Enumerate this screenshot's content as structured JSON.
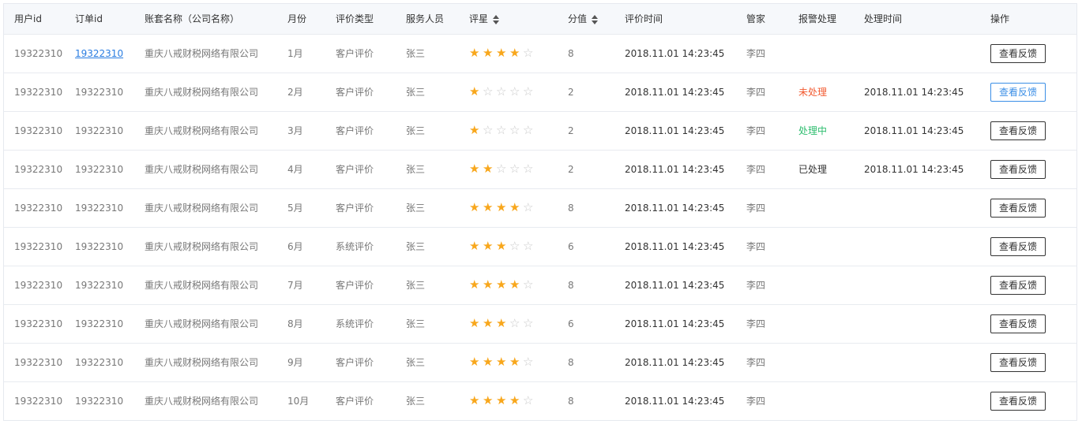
{
  "columns": {
    "user_id": "用户id",
    "order_id": "订单id",
    "account_name": "账套名称（公司名称）",
    "month": "月份",
    "eval_type": "评价类型",
    "staff": "服务人员",
    "rating": "评星",
    "score": "分值",
    "eval_time": "评价时间",
    "manager": "管家",
    "alarm": "报警处理",
    "handle_time": "处理时间",
    "actions": "操作"
  },
  "colors": {
    "star_on": "#f8a71c",
    "link": "#2a7de1",
    "status_pending": "#f25a30",
    "status_processing": "#2dbd6e",
    "button_primary": "#3a8ee6"
  },
  "icons": {
    "star": "star-icon",
    "sort": "sort-icon"
  },
  "rows": [
    {
      "user_id": "19322310",
      "order_id": "19322310",
      "account_name": "重庆八戒财税网络有限公司",
      "month": "1月",
      "eval_type": "客户评价",
      "staff": "张三",
      "rating": 4,
      "score": "8",
      "eval_time": "2018.11.01 14:23:45",
      "manager": "李四",
      "alarm": "",
      "alarm_status": "none",
      "handle_time": "",
      "action": "查看反馈",
      "order_link": true,
      "button_highlight": false
    },
    {
      "user_id": "19322310",
      "order_id": "19322310",
      "account_name": "重庆八戒财税网络有限公司",
      "month": "2月",
      "eval_type": "客户评价",
      "staff": "张三",
      "rating": 1,
      "score": "2",
      "eval_time": "2018.11.01 14:23:45",
      "manager": "李四",
      "alarm": "未处理",
      "alarm_status": "pending",
      "handle_time": "2018.11.01 14:23:45",
      "action": "查看反馈",
      "order_link": false,
      "button_highlight": true
    },
    {
      "user_id": "19322310",
      "order_id": "19322310",
      "account_name": "重庆八戒财税网络有限公司",
      "month": "3月",
      "eval_type": "客户评价",
      "staff": "张三",
      "rating": 1,
      "score": "2",
      "eval_time": "2018.11.01 14:23:45",
      "manager": "李四",
      "alarm": "处理中",
      "alarm_status": "processing",
      "handle_time": "2018.11.01 14:23:45",
      "action": "查看反馈",
      "order_link": false,
      "button_highlight": false
    },
    {
      "user_id": "19322310",
      "order_id": "19322310",
      "account_name": "重庆八戒财税网络有限公司",
      "month": "4月",
      "eval_type": "客户评价",
      "staff": "张三",
      "rating": 2,
      "score": "2",
      "eval_time": "2018.11.01 14:23:45",
      "manager": "李四",
      "alarm": "已处理",
      "alarm_status": "done",
      "handle_time": "2018.11.01 14:23:45",
      "action": "查看反馈",
      "order_link": false,
      "button_highlight": false
    },
    {
      "user_id": "19322310",
      "order_id": "19322310",
      "account_name": "重庆八戒财税网络有限公司",
      "month": "5月",
      "eval_type": "客户评价",
      "staff": "张三",
      "rating": 4,
      "score": "8",
      "eval_time": "2018.11.01 14:23:45",
      "manager": "李四",
      "alarm": "",
      "alarm_status": "none",
      "handle_time": "",
      "action": "查看反馈",
      "order_link": false,
      "button_highlight": false
    },
    {
      "user_id": "19322310",
      "order_id": "19322310",
      "account_name": "重庆八戒财税网络有限公司",
      "month": "6月",
      "eval_type": "系统评价",
      "staff": "张三",
      "rating": 3,
      "score": "6",
      "eval_time": "2018.11.01 14:23:45",
      "manager": "李四",
      "alarm": "",
      "alarm_status": "none",
      "handle_time": "",
      "action": "查看反馈",
      "order_link": false,
      "button_highlight": false
    },
    {
      "user_id": "19322310",
      "order_id": "19322310",
      "account_name": "重庆八戒财税网络有限公司",
      "month": "7月",
      "eval_type": "客户评价",
      "staff": "张三",
      "rating": 4,
      "score": "8",
      "eval_time": "2018.11.01 14:23:45",
      "manager": "李四",
      "alarm": "",
      "alarm_status": "none",
      "handle_time": "",
      "action": "查看反馈",
      "order_link": false,
      "button_highlight": false
    },
    {
      "user_id": "19322310",
      "order_id": "19322310",
      "account_name": "重庆八戒财税网络有限公司",
      "month": "8月",
      "eval_type": "系统评价",
      "staff": "张三",
      "rating": 3,
      "score": "6",
      "eval_time": "2018.11.01 14:23:45",
      "manager": "李四",
      "alarm": "",
      "alarm_status": "none",
      "handle_time": "",
      "action": "查看反馈",
      "order_link": false,
      "button_highlight": false
    },
    {
      "user_id": "19322310",
      "order_id": "19322310",
      "account_name": "重庆八戒财税网络有限公司",
      "month": "9月",
      "eval_type": "客户评价",
      "staff": "张三",
      "rating": 4,
      "score": "8",
      "eval_time": "2018.11.01 14:23:45",
      "manager": "李四",
      "alarm": "",
      "alarm_status": "none",
      "handle_time": "",
      "action": "查看反馈",
      "order_link": false,
      "button_highlight": false
    },
    {
      "user_id": "19322310",
      "order_id": "19322310",
      "account_name": "重庆八戒财税网络有限公司",
      "month": "10月",
      "eval_type": "客户评价",
      "staff": "张三",
      "rating": 4,
      "score": "8",
      "eval_time": "2018.11.01 14:23:45",
      "manager": "李四",
      "alarm": "",
      "alarm_status": "none",
      "handle_time": "",
      "action": "查看反馈",
      "order_link": false,
      "button_highlight": false
    }
  ]
}
